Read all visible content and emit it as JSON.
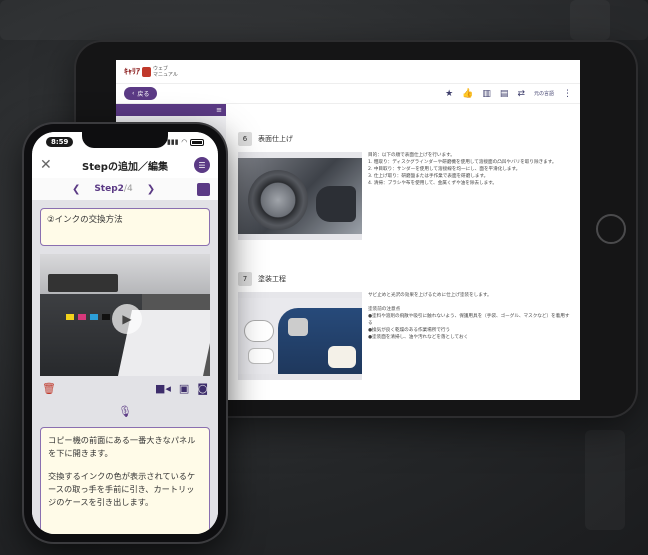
{
  "tablet": {
    "logo": {
      "mark": "ｷｬﾘｱ",
      "line1": "ウェブ",
      "line2": "マニュアル"
    },
    "back_label": "戻る",
    "icons": [
      "star-icon",
      "thumbs-up-icon",
      "book-icon",
      "pdf-icon",
      "translate-icon",
      "more-icon"
    ],
    "translate_label": "元の言語",
    "sidebar_menu_icon": "≡",
    "steps": [
      {
        "number": "6",
        "title": "表面仕上げ",
        "description": [
          "目的：以下の順で表面仕上げを行います。",
          "1. 粗取り：ディスクグラインダーや研磨機を使用して溶接面の凸凹やバリを取り除きます。",
          "2. 中目取り：サンダーを使用して溶接線を均一にし、面を平滑化します。",
          "3. 仕上げ取り：研磨盤または手作業で表面を研磨します。",
          "4. 清掃：ブラシや布を使用して、金属くずや油を除去します。"
        ]
      },
      {
        "number": "7",
        "title": "塗装工程",
        "description": [
          "サビ止めと光沢の効果を上げるために仕上げ塗装をします。",
          "",
          "塗装前の注意点",
          "●塗料や溶剤の飛散や吸引に触れないよう、保護用具を（手袋、ゴーグル、マスクなど）を着用する",
          "●換気が良く乾燥のある作業場所で行う",
          "●塗装面を清掃し、油や汚れなどを落としておく"
        ]
      }
    ]
  },
  "phone": {
    "time": "8:59",
    "header_title": "Stepの追加／編集",
    "step_current": "Step2",
    "step_total": "/4",
    "step_title": "②インクの交換方法",
    "text_paragraphs": [
      "コピー機の前面にある一番大きなパネルを下に開きます。",
      "交換するインクの色が表示されているケースの取っ手を手前に引き、カートリッジのケースを引き出します。"
    ]
  }
}
